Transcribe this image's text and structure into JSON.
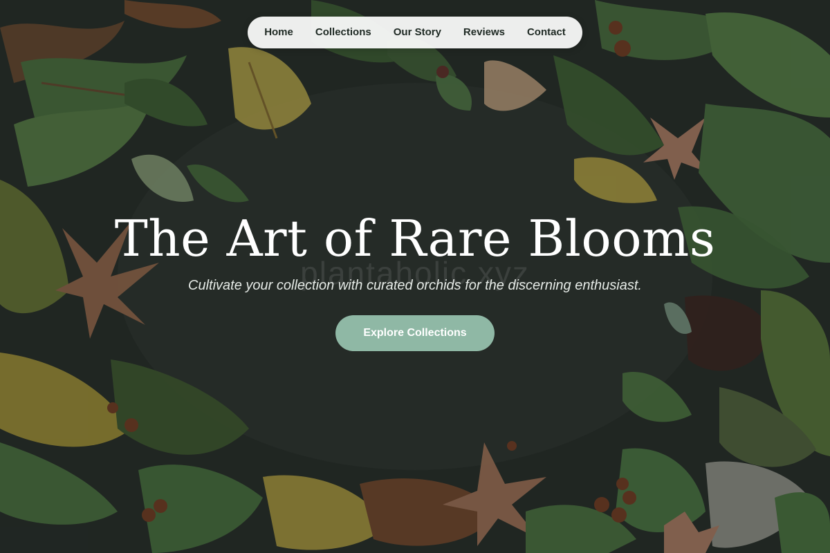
{
  "nav": {
    "items": [
      {
        "label": "Home"
      },
      {
        "label": "Collections"
      },
      {
        "label": "Our Story"
      },
      {
        "label": "Reviews"
      },
      {
        "label": "Contact"
      }
    ]
  },
  "hero": {
    "title": "The Art of Rare Blooms",
    "watermark": "plantaholic.xyz",
    "subtitle": "Cultivate your collection with curated orchids for the discerning enthusiast.",
    "cta_label": "Explore Collections"
  },
  "colors": {
    "background": "#262c29",
    "nav_background": "#ffffff",
    "cta_background": "#8fb8a5",
    "foliage_green": "#4f7a42",
    "foliage_yellow": "#b9a84a",
    "leaf_brown": "#a8765a"
  }
}
